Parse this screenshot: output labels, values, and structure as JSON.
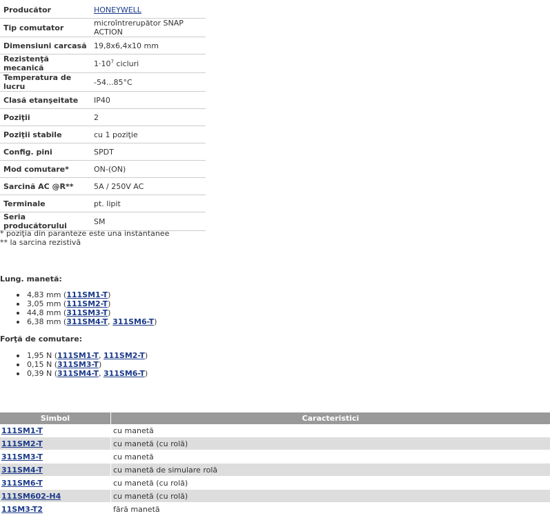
{
  "specs": [
    {
      "label": "Producător",
      "value": "HONEYWELL",
      "link": true
    },
    {
      "label": "Tip comutator",
      "value": "microîntrerupător SNAP ACTION"
    },
    {
      "label": "Dimensiuni carcasă",
      "value": "19,8x6,4x10 mm"
    },
    {
      "label": "Rezistenţă mecanică",
      "value_pre": "1·10",
      "value_sup": "7",
      "value_post": " cicluri"
    },
    {
      "label": "Temperatura de lucru",
      "value": "-54...85°C"
    },
    {
      "label": "Clasă etanşeitate",
      "value": "IP40"
    },
    {
      "label": "Poziţii",
      "value": "2"
    },
    {
      "label": "Poziţii stabile",
      "value": "cu 1 poziţie"
    },
    {
      "label": "Config. pini",
      "value": "SPDT"
    },
    {
      "label": "Mod comutare*",
      "value": "ON-(ON)"
    },
    {
      "label": "Sarcină AC @R**",
      "value": "5A / 250V AC"
    },
    {
      "label": "Terminale",
      "value": "pt. lipit"
    },
    {
      "label": "Seria producătorului",
      "value": "SM"
    }
  ],
  "notes": {
    "n1": "* poziţia din paranteze este una instantanee",
    "n2": "** la sarcina rezistivă"
  },
  "lever": {
    "title": "Lung. manetă:",
    "items": [
      {
        "value": "4,83 mm",
        "parts": [
          "111SM1-T"
        ]
      },
      {
        "value": "3,05 mm",
        "parts": [
          "111SM2-T"
        ]
      },
      {
        "value": "44,8 mm",
        "parts": [
          "311SM3-T"
        ]
      },
      {
        "value": "6,38 mm",
        "parts": [
          "311SM4-T",
          "311SM6-T"
        ]
      }
    ]
  },
  "force": {
    "title": "Forţă de comutare:",
    "items": [
      {
        "value": "1,95 N",
        "parts": [
          "111SM1-T",
          "111SM2-T"
        ]
      },
      {
        "value": "0,15 N",
        "parts": [
          "311SM3-T"
        ]
      },
      {
        "value": "0,39 N",
        "parts": [
          "311SM4-T",
          "311SM6-T"
        ]
      }
    ]
  },
  "table": {
    "headers": {
      "symbol": "Simbol",
      "characteristics": "Caracteristici"
    },
    "rows": [
      {
        "symbol": "111SM1-T",
        "desc": "cu manetă"
      },
      {
        "symbol": "111SM2-T",
        "desc": "cu manetă (cu rolă)"
      },
      {
        "symbol": "311SM3-T",
        "desc": "cu manetă"
      },
      {
        "symbol": "311SM4-T",
        "desc": "cu manetă de simulare rolă"
      },
      {
        "symbol": "311SM6-T",
        "desc": "cu manetă (cu rolă)"
      },
      {
        "symbol": "111SM602-H4",
        "desc": "cu manetă (cu rolă)"
      },
      {
        "symbol": "11SM3-T2",
        "desc": "fără manetă"
      }
    ]
  },
  "colors": {
    "link": "#1a3a8a",
    "header_bg": "#999999",
    "alt_row_bg": "#dddddd",
    "text": "#333333"
  }
}
